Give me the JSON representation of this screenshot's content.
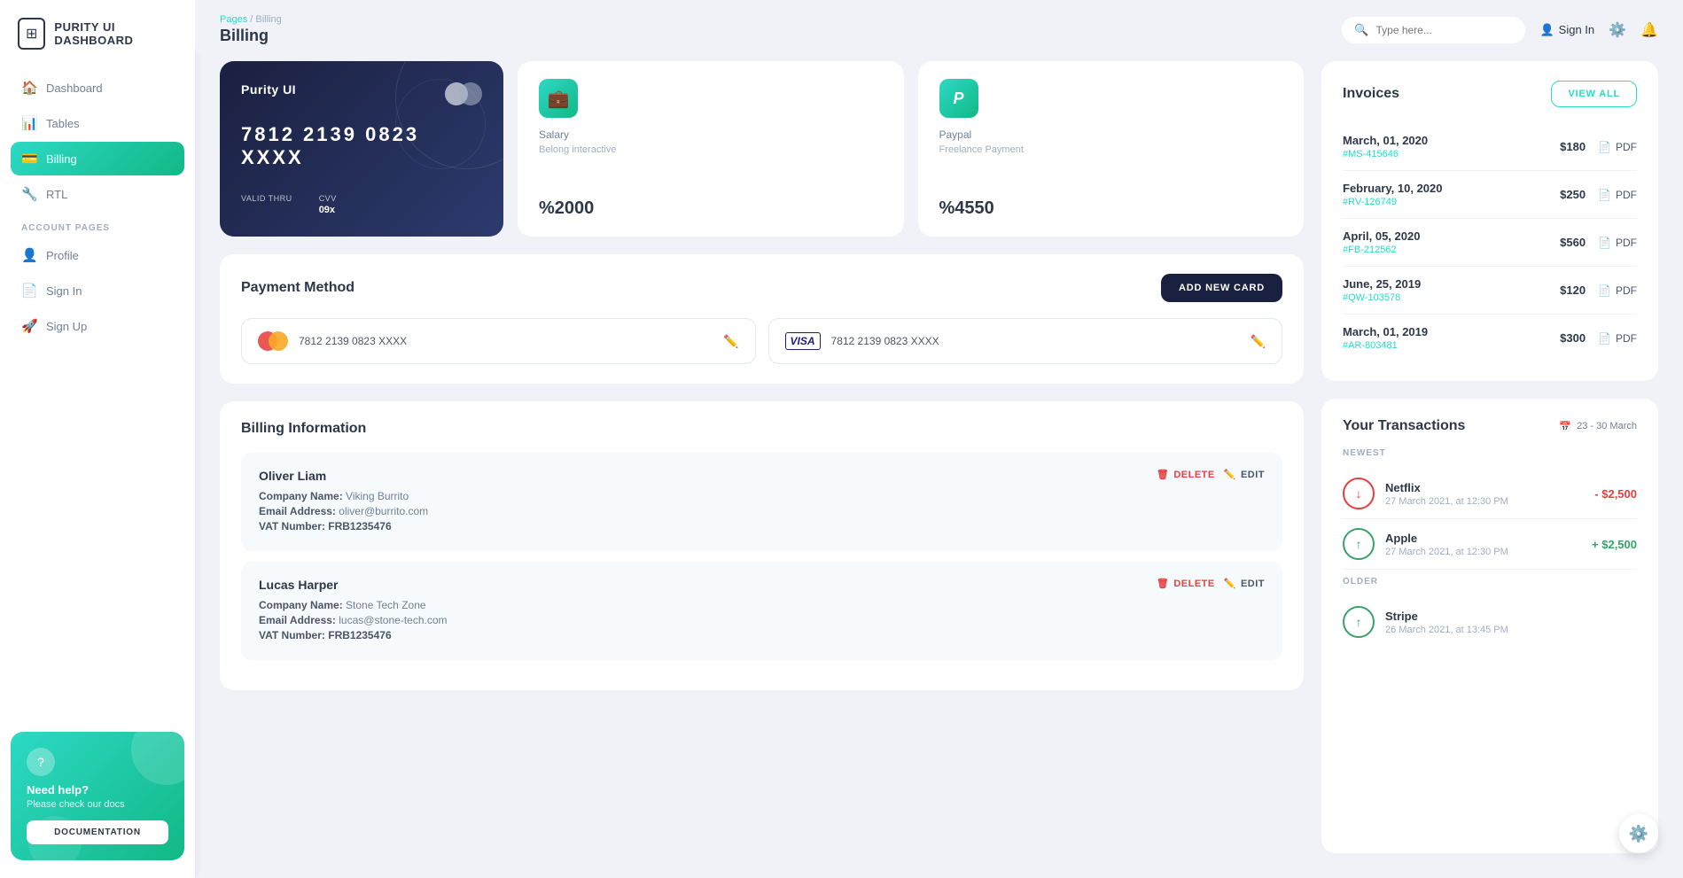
{
  "app": {
    "name": "PURITY UI DASHBOARD"
  },
  "sidebar": {
    "nav_items": [
      {
        "id": "dashboard",
        "label": "Dashboard",
        "icon": "🏠",
        "active": false
      },
      {
        "id": "tables",
        "label": "Tables",
        "icon": "📊",
        "active": false
      },
      {
        "id": "billing",
        "label": "Billing",
        "icon": "💳",
        "active": true
      },
      {
        "id": "rtl",
        "label": "RTL",
        "icon": "🔧",
        "active": false
      }
    ],
    "account_section": "ACCOUNT PAGES",
    "account_items": [
      {
        "id": "profile",
        "label": "Profile",
        "icon": "👤",
        "active": false
      },
      {
        "id": "signin",
        "label": "Sign In",
        "icon": "📄",
        "active": false
      },
      {
        "id": "signup",
        "label": "Sign Up",
        "icon": "🚀",
        "active": false
      }
    ],
    "help": {
      "icon": "?",
      "title": "Need help?",
      "subtitle": "Please check our docs",
      "button_label": "DOCUMENTATION"
    }
  },
  "header": {
    "breadcrumb_path": "Pages",
    "breadcrumb_separator": "/",
    "breadcrumb_current": "Billing",
    "page_title": "Billing",
    "search_placeholder": "Type here...",
    "sign_in_label": "Sign In"
  },
  "credit_card": {
    "brand": "Purity UI",
    "number": "7812 2139 0823 XXXX",
    "valid_thru_label": "VALID THRU",
    "valid_thru_value": "",
    "cvv_label": "CVV",
    "cvv_value": "09x"
  },
  "stat_cards": [
    {
      "id": "salary",
      "icon": "💼",
      "label": "Salary",
      "sublabel": "Belong interactive",
      "value": "%2000"
    },
    {
      "id": "paypal",
      "icon": "P",
      "label": "Paypal",
      "sublabel": "Freelance Payment",
      "value": "%4550"
    }
  ],
  "payment_method": {
    "title": "Payment Method",
    "add_button": "ADD NEW CARD",
    "cards": [
      {
        "type": "mastercard",
        "number": "7812 2139 0823 XXXX"
      },
      {
        "type": "visa",
        "number": "7812 2139 0823 XXXX"
      }
    ]
  },
  "billing_information": {
    "title": "Billing Information",
    "persons": [
      {
        "name": "Oliver Liam",
        "company_label": "Company Name:",
        "company": "Viking Burrito",
        "email_label": "Email Address:",
        "email": "oliver@burrito.com",
        "vat_label": "VAT Number:",
        "vat": "FRB1235476"
      },
      {
        "name": "Lucas Harper",
        "company_label": "Company Name:",
        "company": "Stone Tech Zone",
        "email_label": "Email Address:",
        "email": "lucas@stone-tech.com",
        "vat_label": "VAT Number:",
        "vat": "FRB1235476"
      }
    ],
    "delete_label": "DELETE",
    "edit_label": "EDIT"
  },
  "invoices": {
    "title": "Invoices",
    "view_all_label": "VIEW ALL",
    "items": [
      {
        "date": "March, 01, 2020",
        "ref": "#MS-415646",
        "amount": "$180"
      },
      {
        "date": "February, 10, 2020",
        "ref": "#RV-126749",
        "amount": "$250"
      },
      {
        "date": "April, 05, 2020",
        "ref": "#FB-212562",
        "amount": "$560"
      },
      {
        "date": "June, 25, 2019",
        "ref": "#QW-103578",
        "amount": "$120"
      },
      {
        "date": "March, 01, 2019",
        "ref": "#AR-803481",
        "amount": "$300"
      }
    ],
    "pdf_label": "PDF"
  },
  "transactions": {
    "title": "Your Transactions",
    "date_range": "23 - 30 March",
    "newest_label": "NEWEST",
    "older_label": "OLDER",
    "items": [
      {
        "name": "Netflix",
        "date": "27 March 2021, at 12:30 PM",
        "amount": "- $2,500",
        "type": "down",
        "group": "newest"
      },
      {
        "name": "Apple",
        "date": "27 March 2021, at 12:30 PM",
        "amount": "+ $2,500",
        "type": "up",
        "group": "newest"
      },
      {
        "name": "Stripe",
        "date": "26 March 2021, at 13:45 PM",
        "amount": "",
        "type": "up",
        "group": "older"
      }
    ]
  },
  "colors": {
    "accent": "#2cd9c5",
    "dark": "#1a2040",
    "danger": "#e53e3e",
    "success": "#38a169"
  }
}
